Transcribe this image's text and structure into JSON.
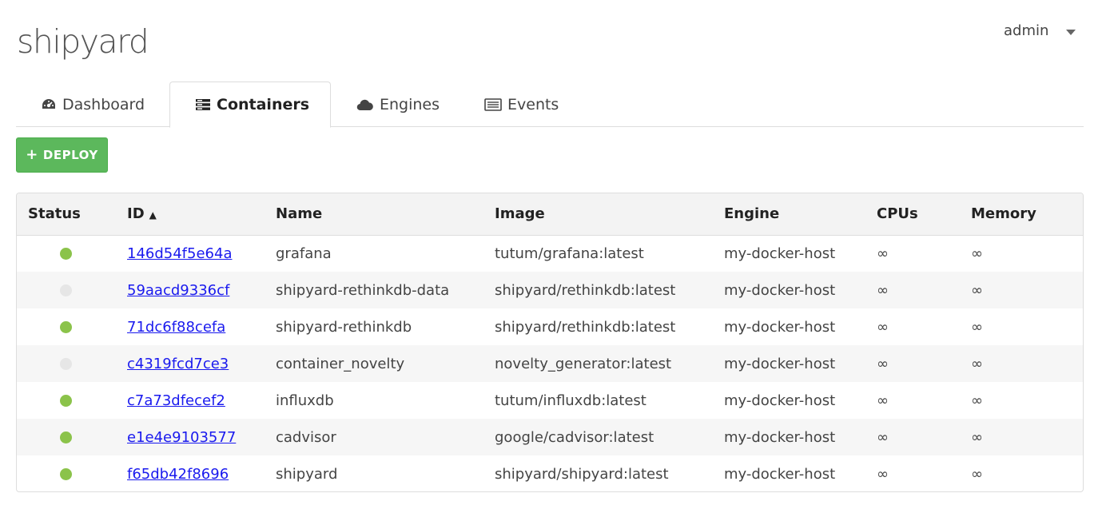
{
  "app": {
    "logo": "shipyard"
  },
  "user": {
    "name": "admin"
  },
  "tabs": [
    {
      "label": "Dashboard",
      "icon": "dashboard-icon"
    },
    {
      "label": "Containers",
      "icon": "containers-icon",
      "active": true
    },
    {
      "label": "Engines",
      "icon": "cloud-icon"
    },
    {
      "label": "Events",
      "icon": "list-icon"
    }
  ],
  "toolbar": {
    "deploy_label": "DEPLOY",
    "deploy_icon": "plus-icon"
  },
  "table": {
    "headers": [
      "Status",
      "ID",
      "Name",
      "Image",
      "Engine",
      "CPUs",
      "Memory"
    ],
    "sort": {
      "column": "ID",
      "indicator": "▲"
    },
    "status_colors": {
      "running": "#8bc34a",
      "stopped": "#e6e6e6"
    },
    "rows": [
      {
        "status": "running",
        "id": "146d54f5e64a",
        "name": "grafana",
        "image": "tutum/grafana:latest",
        "engine": "my-docker-host",
        "cpus": "∞",
        "memory": "∞"
      },
      {
        "status": "stopped",
        "id": "59aacd9336cf",
        "name": "shipyard-rethinkdb-data",
        "image": "shipyard/rethinkdb:latest",
        "engine": "my-docker-host",
        "cpus": "∞",
        "memory": "∞"
      },
      {
        "status": "running",
        "id": "71dc6f88cefa",
        "name": "shipyard-rethinkdb",
        "image": "shipyard/rethinkdb:latest",
        "engine": "my-docker-host",
        "cpus": "∞",
        "memory": "∞"
      },
      {
        "status": "stopped",
        "id": "c4319fcd7ce3",
        "name": "container_novelty",
        "image": "novelty_generator:latest",
        "engine": "my-docker-host",
        "cpus": "∞",
        "memory": "∞"
      },
      {
        "status": "running",
        "id": "c7a73dfecef2",
        "name": "influxdb",
        "image": "tutum/influxdb:latest",
        "engine": "my-docker-host",
        "cpus": "∞",
        "memory": "∞"
      },
      {
        "status": "running",
        "id": "e1e4e9103577",
        "name": "cadvisor",
        "image": "google/cadvisor:latest",
        "engine": "my-docker-host",
        "cpus": "∞",
        "memory": "∞"
      },
      {
        "status": "running",
        "id": "f65db42f8696",
        "name": "shipyard",
        "image": "shipyard/shipyard:latest",
        "engine": "my-docker-host",
        "cpus": "∞",
        "memory": "∞"
      }
    ]
  }
}
